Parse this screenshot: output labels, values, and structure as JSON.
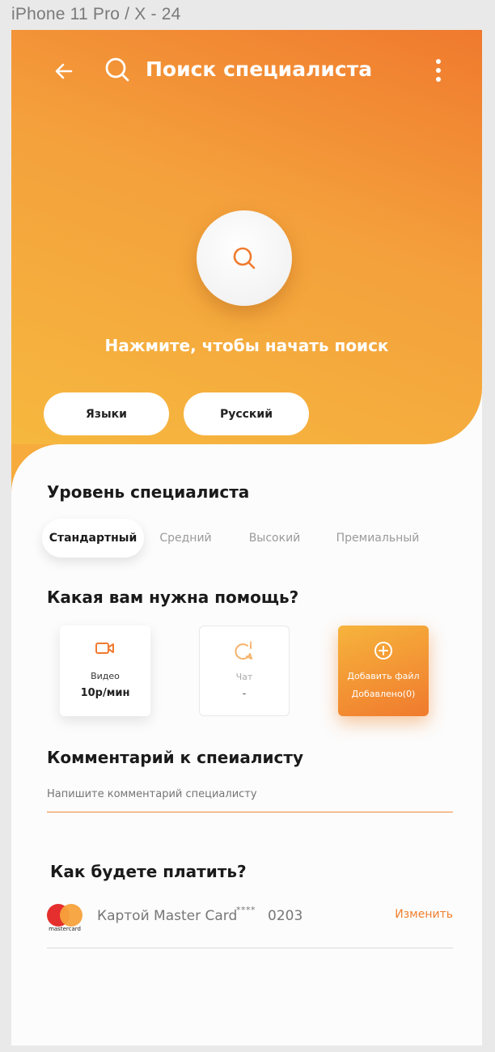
{
  "frame_label": "iPhone 11 Pro / X - 24",
  "colors": {
    "accent": "#f07a2e",
    "accent_light": "#f6b83e",
    "mastercard_red": "#e52e2e",
    "mastercard_orange": "#f7a23b"
  },
  "header": {
    "title": "Поиск специалиста",
    "back_icon": "arrow-left-icon",
    "search_icon": "search-icon",
    "menu_icon": "kebab-menu-icon"
  },
  "hero": {
    "tap_text": "Нажмите, чтобы начать поиск",
    "filters": [
      "Языки",
      "Русский"
    ]
  },
  "level": {
    "title": "Уровень специалиста",
    "options": [
      "Стандартный",
      "Средний",
      "Высокий",
      "Премиальный"
    ],
    "selected": "Стандартный"
  },
  "help": {
    "title": "Какая вам нужна помощь?",
    "cards": [
      {
        "icon": "video-camera-icon",
        "label": "Видео",
        "value": "10р/мин"
      },
      {
        "icon": "chat-icon",
        "label": "Чат",
        "value": "-"
      },
      {
        "icon": "add-circle-icon",
        "label": "Добавить файл",
        "value": "Добавлено(0)"
      }
    ]
  },
  "comment": {
    "title": "Комментарий к спеиалисту",
    "placeholder": "Напишите комментарий специалисту"
  },
  "payment": {
    "title": "Как будете платить?",
    "logo_text": "mastercard",
    "method": "Картой Master Card",
    "masked": "****",
    "last_digits": "0203",
    "change_label": "Изменить"
  }
}
